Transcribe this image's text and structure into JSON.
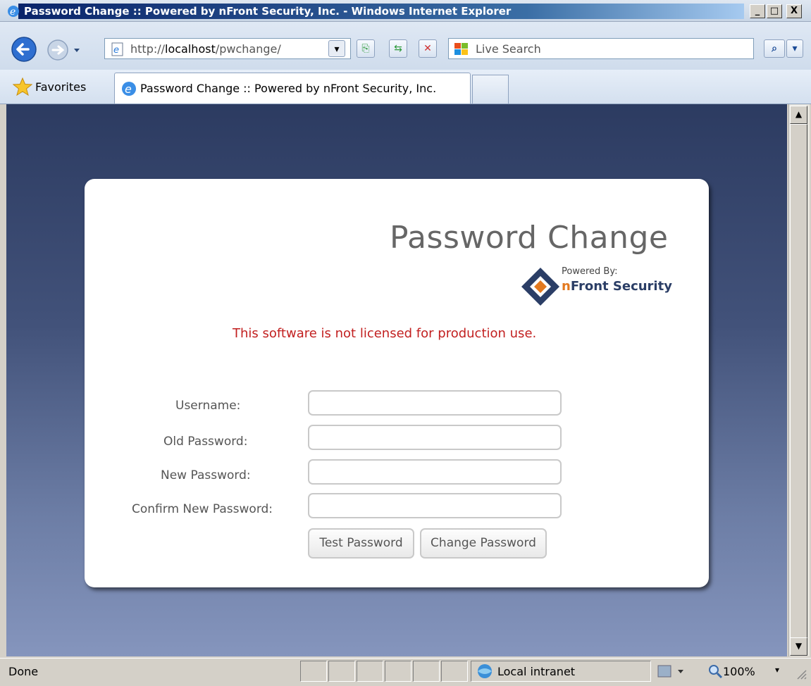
{
  "window": {
    "title": "Password Change :: Powered by nFront Security, Inc. - Windows Internet Explorer",
    "minimize": "_",
    "maximize": "□",
    "close": "X"
  },
  "nav": {
    "address_prefix": "http://",
    "address_host": "localhost",
    "address_path": "/pwchange/",
    "search_placeholder": "Live Search"
  },
  "favbar": {
    "favorites_label": "Favorites",
    "tab_label": "Password Change :: Powered by nFront Security, Inc."
  },
  "page": {
    "title": "Password Change",
    "powered_by": "Powered By:",
    "brand_n": "n",
    "brand_rest": "Front Security",
    "warning": "This software is not licensed for production use.",
    "labels": {
      "username": "Username:",
      "old_password": "Old Password:",
      "new_password": "New Password:",
      "confirm_password": "Confirm New Password:"
    },
    "values": {
      "username": "",
      "old_password": "",
      "new_password": "",
      "confirm_password": ""
    },
    "buttons": {
      "test": "Test Password",
      "change": "Change Password"
    }
  },
  "status": {
    "text": "Done",
    "zone": "Local intranet",
    "zoom": "100%"
  }
}
